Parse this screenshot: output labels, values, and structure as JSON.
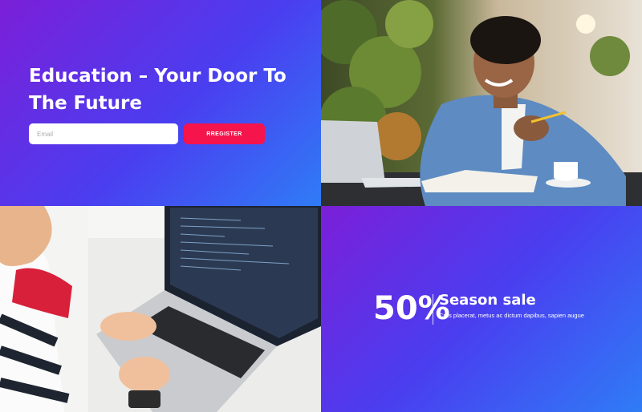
{
  "hero": {
    "title": "Education – Your Door To The Future",
    "email_placeholder": "Email",
    "register_label": "RREGISTER"
  },
  "promo": {
    "percent": "50%",
    "title": "Season sale",
    "subtitle": "Cras placerat, metus ac dictum dapibus, sapien augue"
  },
  "colors": {
    "gradient_start": "#7b1fd8",
    "gradient_end": "#2f7cf6",
    "accent": "#f5144b"
  }
}
